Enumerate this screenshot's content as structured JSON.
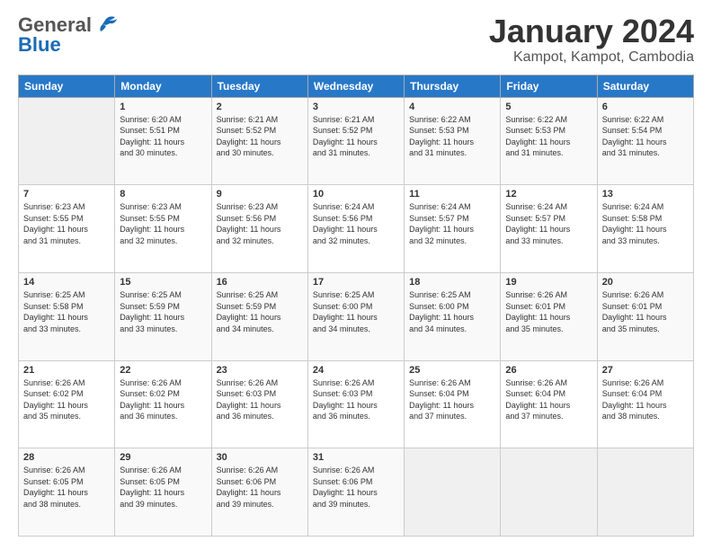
{
  "logo": {
    "general": "General",
    "blue": "Blue"
  },
  "title": "January 2024",
  "location": "Kampot, Kampot, Cambodia",
  "days_header": [
    "Sunday",
    "Monday",
    "Tuesday",
    "Wednesday",
    "Thursday",
    "Friday",
    "Saturday"
  ],
  "weeks": [
    [
      {
        "day": "",
        "info": ""
      },
      {
        "day": "1",
        "info": "Sunrise: 6:20 AM\nSunset: 5:51 PM\nDaylight: 11 hours\nand 30 minutes."
      },
      {
        "day": "2",
        "info": "Sunrise: 6:21 AM\nSunset: 5:52 PM\nDaylight: 11 hours\nand 30 minutes."
      },
      {
        "day": "3",
        "info": "Sunrise: 6:21 AM\nSunset: 5:52 PM\nDaylight: 11 hours\nand 31 minutes."
      },
      {
        "day": "4",
        "info": "Sunrise: 6:22 AM\nSunset: 5:53 PM\nDaylight: 11 hours\nand 31 minutes."
      },
      {
        "day": "5",
        "info": "Sunrise: 6:22 AM\nSunset: 5:53 PM\nDaylight: 11 hours\nand 31 minutes."
      },
      {
        "day": "6",
        "info": "Sunrise: 6:22 AM\nSunset: 5:54 PM\nDaylight: 11 hours\nand 31 minutes."
      }
    ],
    [
      {
        "day": "7",
        "info": "Sunrise: 6:23 AM\nSunset: 5:55 PM\nDaylight: 11 hours\nand 31 minutes."
      },
      {
        "day": "8",
        "info": "Sunrise: 6:23 AM\nSunset: 5:55 PM\nDaylight: 11 hours\nand 32 minutes."
      },
      {
        "day": "9",
        "info": "Sunrise: 6:23 AM\nSunset: 5:56 PM\nDaylight: 11 hours\nand 32 minutes."
      },
      {
        "day": "10",
        "info": "Sunrise: 6:24 AM\nSunset: 5:56 PM\nDaylight: 11 hours\nand 32 minutes."
      },
      {
        "day": "11",
        "info": "Sunrise: 6:24 AM\nSunset: 5:57 PM\nDaylight: 11 hours\nand 32 minutes."
      },
      {
        "day": "12",
        "info": "Sunrise: 6:24 AM\nSunset: 5:57 PM\nDaylight: 11 hours\nand 33 minutes."
      },
      {
        "day": "13",
        "info": "Sunrise: 6:24 AM\nSunset: 5:58 PM\nDaylight: 11 hours\nand 33 minutes."
      }
    ],
    [
      {
        "day": "14",
        "info": "Sunrise: 6:25 AM\nSunset: 5:58 PM\nDaylight: 11 hours\nand 33 minutes."
      },
      {
        "day": "15",
        "info": "Sunrise: 6:25 AM\nSunset: 5:59 PM\nDaylight: 11 hours\nand 33 minutes."
      },
      {
        "day": "16",
        "info": "Sunrise: 6:25 AM\nSunset: 5:59 PM\nDaylight: 11 hours\nand 34 minutes."
      },
      {
        "day": "17",
        "info": "Sunrise: 6:25 AM\nSunset: 6:00 PM\nDaylight: 11 hours\nand 34 minutes."
      },
      {
        "day": "18",
        "info": "Sunrise: 6:25 AM\nSunset: 6:00 PM\nDaylight: 11 hours\nand 34 minutes."
      },
      {
        "day": "19",
        "info": "Sunrise: 6:26 AM\nSunset: 6:01 PM\nDaylight: 11 hours\nand 35 minutes."
      },
      {
        "day": "20",
        "info": "Sunrise: 6:26 AM\nSunset: 6:01 PM\nDaylight: 11 hours\nand 35 minutes."
      }
    ],
    [
      {
        "day": "21",
        "info": "Sunrise: 6:26 AM\nSunset: 6:02 PM\nDaylight: 11 hours\nand 35 minutes."
      },
      {
        "day": "22",
        "info": "Sunrise: 6:26 AM\nSunset: 6:02 PM\nDaylight: 11 hours\nand 36 minutes."
      },
      {
        "day": "23",
        "info": "Sunrise: 6:26 AM\nSunset: 6:03 PM\nDaylight: 11 hours\nand 36 minutes."
      },
      {
        "day": "24",
        "info": "Sunrise: 6:26 AM\nSunset: 6:03 PM\nDaylight: 11 hours\nand 36 minutes."
      },
      {
        "day": "25",
        "info": "Sunrise: 6:26 AM\nSunset: 6:04 PM\nDaylight: 11 hours\nand 37 minutes."
      },
      {
        "day": "26",
        "info": "Sunrise: 6:26 AM\nSunset: 6:04 PM\nDaylight: 11 hours\nand 37 minutes."
      },
      {
        "day": "27",
        "info": "Sunrise: 6:26 AM\nSunset: 6:04 PM\nDaylight: 11 hours\nand 38 minutes."
      }
    ],
    [
      {
        "day": "28",
        "info": "Sunrise: 6:26 AM\nSunset: 6:05 PM\nDaylight: 11 hours\nand 38 minutes."
      },
      {
        "day": "29",
        "info": "Sunrise: 6:26 AM\nSunset: 6:05 PM\nDaylight: 11 hours\nand 39 minutes."
      },
      {
        "day": "30",
        "info": "Sunrise: 6:26 AM\nSunset: 6:06 PM\nDaylight: 11 hours\nand 39 minutes."
      },
      {
        "day": "31",
        "info": "Sunrise: 6:26 AM\nSunset: 6:06 PM\nDaylight: 11 hours\nand 39 minutes."
      },
      {
        "day": "",
        "info": ""
      },
      {
        "day": "",
        "info": ""
      },
      {
        "day": "",
        "info": ""
      }
    ]
  ]
}
